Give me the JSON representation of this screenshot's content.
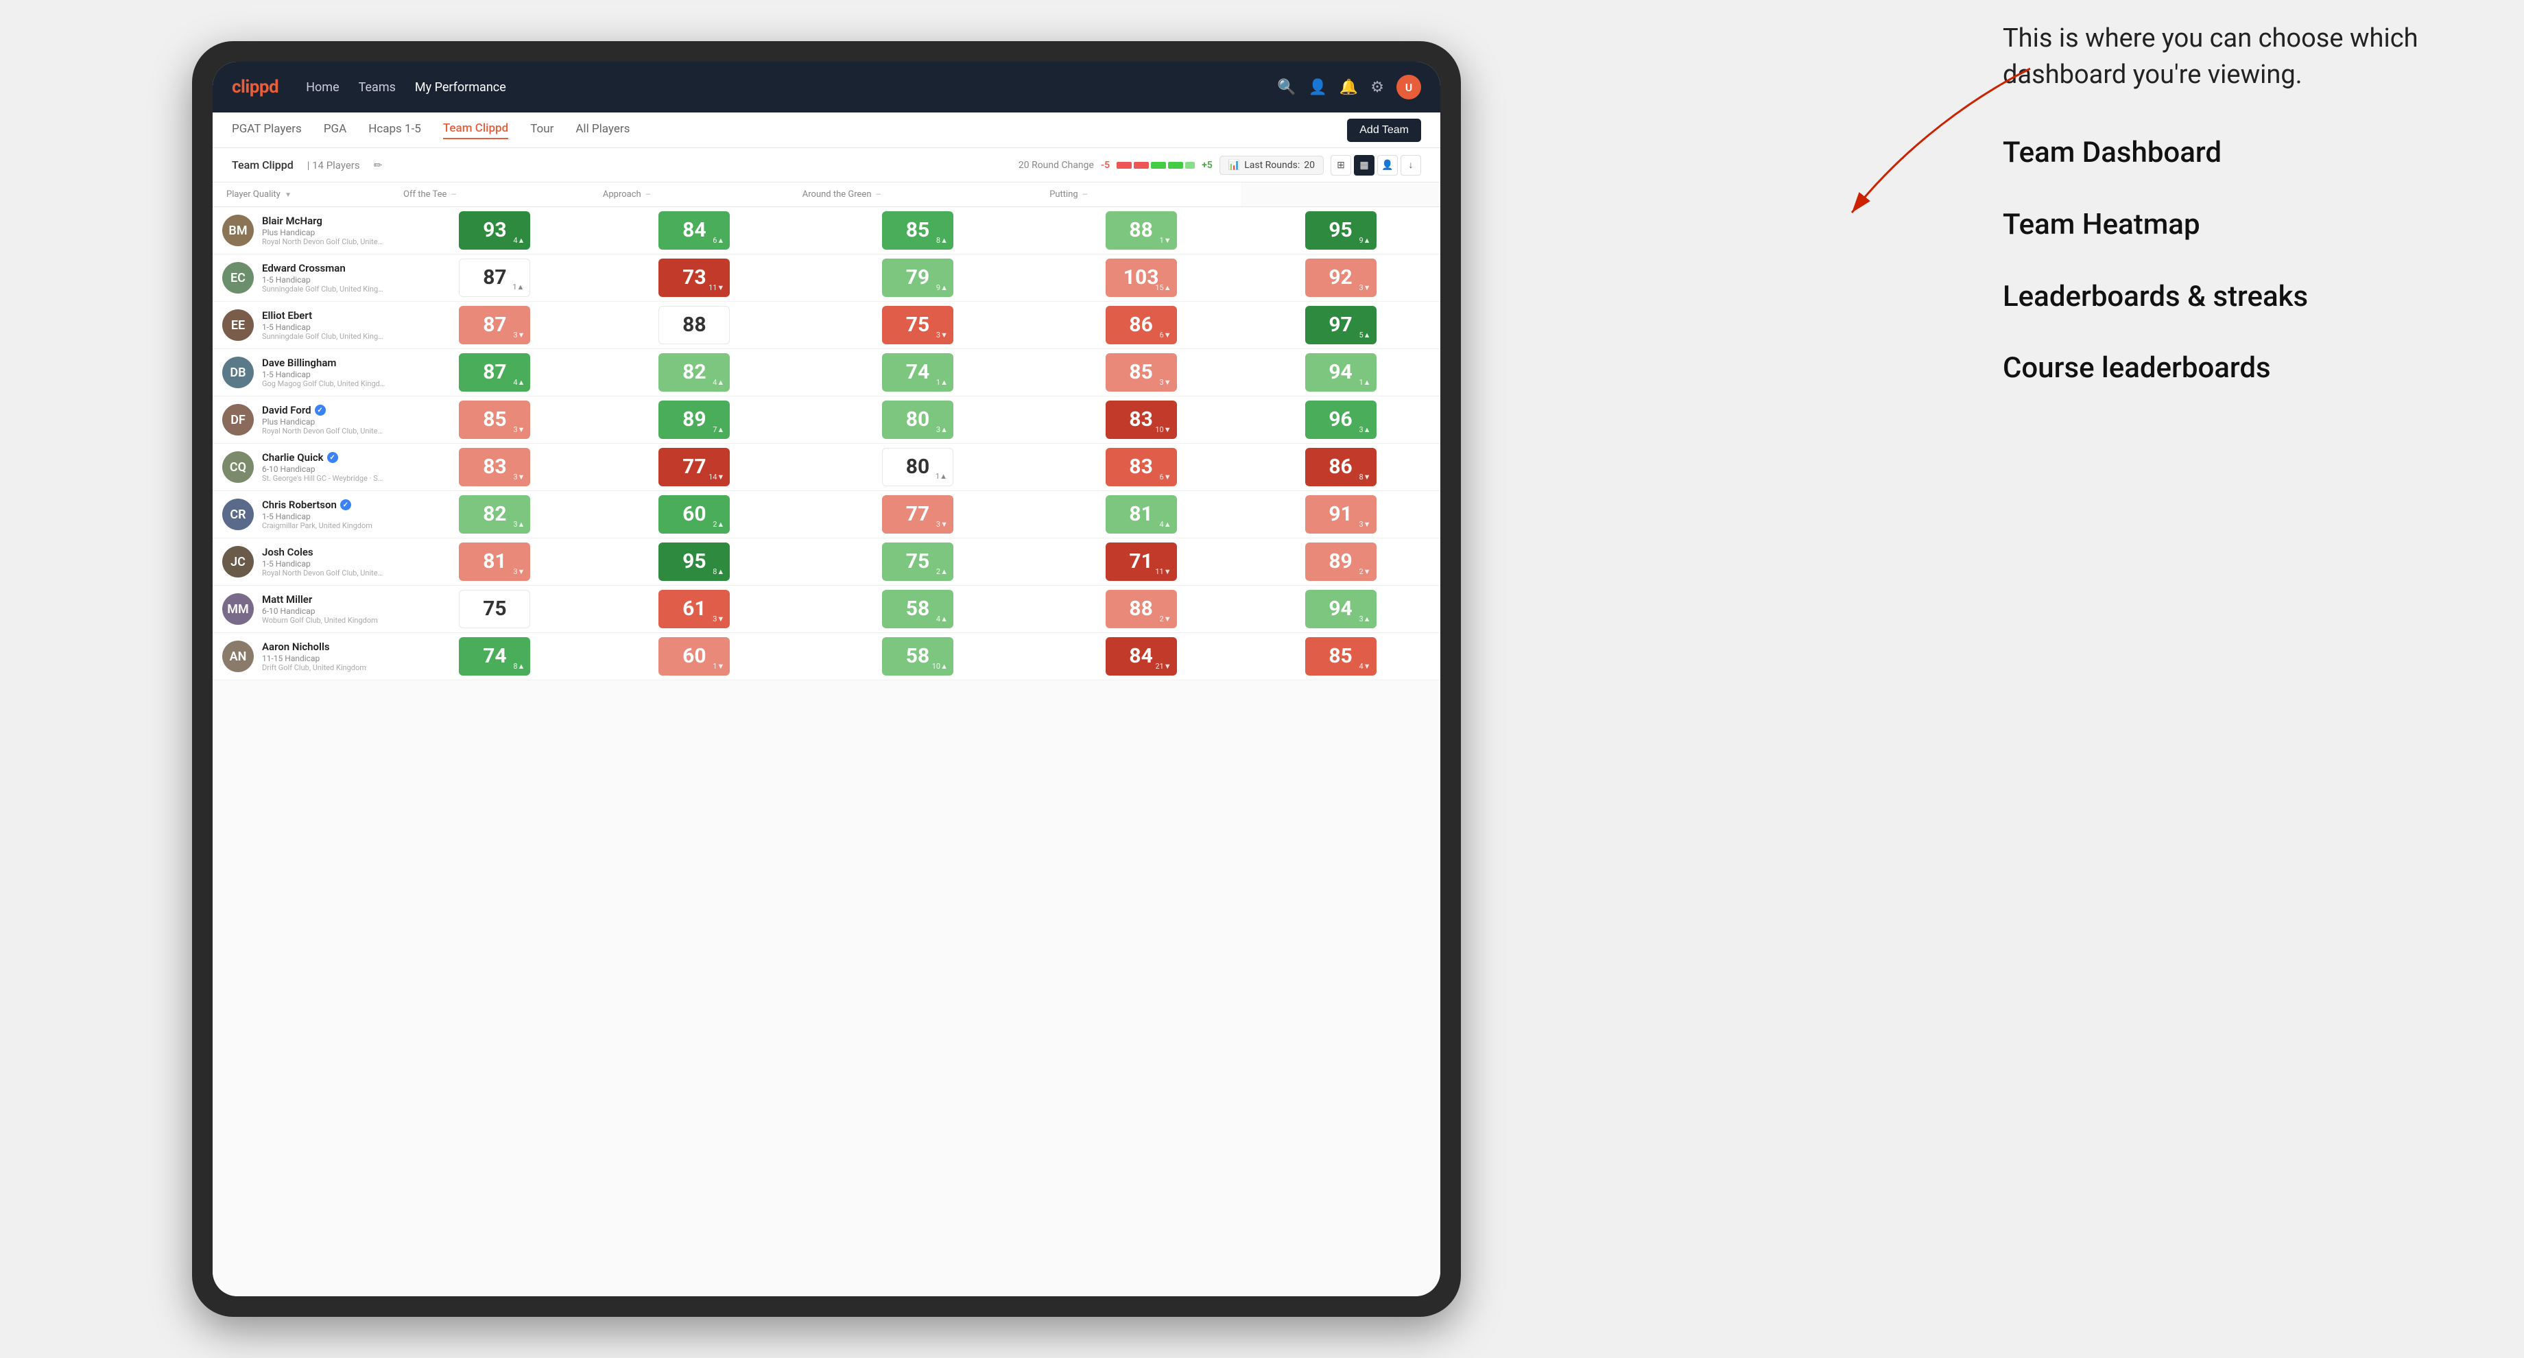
{
  "annotation": {
    "intro": "This is where you can choose which dashboard you're viewing.",
    "items": [
      "Team Dashboard",
      "Team Heatmap",
      "Leaderboards & streaks",
      "Course leaderboards"
    ]
  },
  "navbar": {
    "logo": "clippd",
    "links": [
      "Home",
      "Teams",
      "My Performance"
    ],
    "active_link": "My Performance"
  },
  "subnav": {
    "links": [
      "PGAT Players",
      "PGA",
      "Hcaps 1-5",
      "Team Clippd",
      "Tour",
      "All Players"
    ],
    "active_link": "Team Clippd",
    "add_team_label": "Add Team"
  },
  "team_bar": {
    "team_name": "Team Clippd",
    "separator": "|",
    "player_count": "14 Players",
    "round_change_label": "20 Round Change",
    "round_negative": "-5",
    "round_positive": "+5",
    "last_rounds_label": "Last Rounds:",
    "last_rounds_value": "20"
  },
  "table": {
    "headers": {
      "player": "Player Quality",
      "off_tee": "Off the Tee",
      "approach": "Approach",
      "around_green": "Around the Green",
      "putting": "Putting"
    },
    "players": [
      {
        "name": "Blair McHarg",
        "handicap": "Plus Handicap",
        "club": "Royal North Devon Golf Club, United Kingdom",
        "avatar_color": "#8B7355",
        "initials": "BM",
        "player_quality": {
          "value": 93,
          "change": "+4",
          "direction": "up",
          "color": "green-dark"
        },
        "off_tee": {
          "value": 84,
          "change": "+6",
          "direction": "up",
          "color": "green-mid"
        },
        "approach": {
          "value": 85,
          "change": "+8",
          "direction": "up",
          "color": "green-mid"
        },
        "around_green": {
          "value": 88,
          "change": "-1",
          "direction": "down",
          "color": "green-light"
        },
        "putting": {
          "value": 95,
          "change": "+9",
          "direction": "up",
          "color": "green-dark"
        }
      },
      {
        "name": "Edward Crossman",
        "handicap": "1-5 Handicap",
        "club": "Sunningdale Golf Club, United Kingdom",
        "avatar_color": "#6B8E6B",
        "initials": "EC",
        "player_quality": {
          "value": 87,
          "change": "+1",
          "direction": "up",
          "color": "white"
        },
        "off_tee": {
          "value": 73,
          "change": "-11",
          "direction": "down",
          "color": "red-dark"
        },
        "approach": {
          "value": 79,
          "change": "+9",
          "direction": "up",
          "color": "green-light"
        },
        "around_green": {
          "value": 103,
          "change": "+15",
          "direction": "up",
          "color": "red-light"
        },
        "putting": {
          "value": 92,
          "change": "-3",
          "direction": "down",
          "color": "red-light"
        }
      },
      {
        "name": "Elliot Ebert",
        "handicap": "1-5 Handicap",
        "club": "Sunningdale Golf Club, United Kingdom",
        "avatar_color": "#7A5C4A",
        "initials": "EE",
        "player_quality": {
          "value": 87,
          "change": "-3",
          "direction": "down",
          "color": "red-light"
        },
        "off_tee": {
          "value": 88,
          "change": "",
          "direction": "",
          "color": "white"
        },
        "approach": {
          "value": 75,
          "change": "-3",
          "direction": "down",
          "color": "red-mid"
        },
        "around_green": {
          "value": 86,
          "change": "-6",
          "direction": "down",
          "color": "red-mid"
        },
        "putting": {
          "value": 97,
          "change": "+5",
          "direction": "up",
          "color": "green-dark"
        }
      },
      {
        "name": "Dave Billingham",
        "handicap": "1-5 Handicap",
        "club": "Gog Magog Golf Club, United Kingdom",
        "avatar_color": "#5A7A8A",
        "initials": "DB",
        "player_quality": {
          "value": 87,
          "change": "+4",
          "direction": "up",
          "color": "green-mid"
        },
        "off_tee": {
          "value": 82,
          "change": "+4",
          "direction": "up",
          "color": "green-light"
        },
        "approach": {
          "value": 74,
          "change": "+1",
          "direction": "up",
          "color": "green-light"
        },
        "around_green": {
          "value": 85,
          "change": "-3",
          "direction": "down",
          "color": "red-light"
        },
        "putting": {
          "value": 94,
          "change": "+1",
          "direction": "up",
          "color": "green-light"
        }
      },
      {
        "name": "David Ford",
        "handicap": "Plus Handicap",
        "club": "Royal North Devon Golf Club, United Kingdom",
        "avatar_color": "#8A6A5A",
        "initials": "DF",
        "has_badge": true,
        "player_quality": {
          "value": 85,
          "change": "-3",
          "direction": "down",
          "color": "red-light"
        },
        "off_tee": {
          "value": 89,
          "change": "+7",
          "direction": "up",
          "color": "green-mid"
        },
        "approach": {
          "value": 80,
          "change": "+3",
          "direction": "up",
          "color": "green-light"
        },
        "around_green": {
          "value": 83,
          "change": "-10",
          "direction": "down",
          "color": "red-dark"
        },
        "putting": {
          "value": 96,
          "change": "+3",
          "direction": "up",
          "color": "green-mid"
        }
      },
      {
        "name": "Charlie Quick",
        "handicap": "6-10 Handicap",
        "club": "St. George's Hill GC - Weybridge · Surrey, Uni...",
        "avatar_color": "#7A8A6A",
        "initials": "CQ",
        "has_badge": true,
        "player_quality": {
          "value": 83,
          "change": "-3",
          "direction": "down",
          "color": "red-light"
        },
        "off_tee": {
          "value": 77,
          "change": "-14",
          "direction": "down",
          "color": "red-dark"
        },
        "approach": {
          "value": 80,
          "change": "+1",
          "direction": "up",
          "color": "white"
        },
        "around_green": {
          "value": 83,
          "change": "-6",
          "direction": "down",
          "color": "red-mid"
        },
        "putting": {
          "value": 86,
          "change": "-8",
          "direction": "down",
          "color": "red-dark"
        }
      },
      {
        "name": "Chris Robertson",
        "handicap": "1-5 Handicap",
        "club": "Craigmillar Park, United Kingdom",
        "avatar_color": "#5A6A8A",
        "initials": "CR",
        "has_badge": true,
        "player_quality": {
          "value": 82,
          "change": "+3",
          "direction": "up",
          "color": "green-light"
        },
        "off_tee": {
          "value": 60,
          "change": "+2",
          "direction": "up",
          "color": "green-mid"
        },
        "approach": {
          "value": 77,
          "change": "-3",
          "direction": "down",
          "color": "red-light"
        },
        "around_green": {
          "value": 81,
          "change": "+4",
          "direction": "up",
          "color": "green-light"
        },
        "putting": {
          "value": 91,
          "change": "-3",
          "direction": "down",
          "color": "red-light"
        }
      },
      {
        "name": "Josh Coles",
        "handicap": "1-5 Handicap",
        "club": "Royal North Devon Golf Club, United Kingdom",
        "avatar_color": "#6A5A4A",
        "initials": "JC",
        "player_quality": {
          "value": 81,
          "change": "-3",
          "direction": "down",
          "color": "red-light"
        },
        "off_tee": {
          "value": 95,
          "change": "+8",
          "direction": "up",
          "color": "green-dark"
        },
        "approach": {
          "value": 75,
          "change": "+2",
          "direction": "up",
          "color": "green-light"
        },
        "around_green": {
          "value": 71,
          "change": "-11",
          "direction": "down",
          "color": "red-dark"
        },
        "putting": {
          "value": 89,
          "change": "-2",
          "direction": "down",
          "color": "red-light"
        }
      },
      {
        "name": "Matt Miller",
        "handicap": "6-10 Handicap",
        "club": "Woburn Golf Club, United Kingdom",
        "avatar_color": "#7A6A8A",
        "initials": "MM",
        "player_quality": {
          "value": 75,
          "change": "",
          "direction": "",
          "color": "white"
        },
        "off_tee": {
          "value": 61,
          "change": "-3",
          "direction": "down",
          "color": "red-mid"
        },
        "approach": {
          "value": 58,
          "change": "+4",
          "direction": "up",
          "color": "green-light"
        },
        "around_green": {
          "value": 88,
          "change": "-2",
          "direction": "down",
          "color": "red-light"
        },
        "putting": {
          "value": 94,
          "change": "+3",
          "direction": "up",
          "color": "green-light"
        }
      },
      {
        "name": "Aaron Nicholls",
        "handicap": "11-15 Handicap",
        "club": "Drift Golf Club, United Kingdom",
        "avatar_color": "#8A7A6A",
        "initials": "AN",
        "player_quality": {
          "value": 74,
          "change": "+8",
          "direction": "up",
          "color": "green-mid"
        },
        "off_tee": {
          "value": 60,
          "change": "-1",
          "direction": "down",
          "color": "red-light"
        },
        "approach": {
          "value": 58,
          "change": "+10",
          "direction": "up",
          "color": "green-light"
        },
        "around_green": {
          "value": 84,
          "change": "-21",
          "direction": "down",
          "color": "red-dark"
        },
        "putting": {
          "value": 85,
          "change": "-4",
          "direction": "down",
          "color": "red-mid"
        }
      }
    ]
  },
  "colors": {
    "green_dark": "#2d8a3e",
    "green_mid": "#4aad5a",
    "green_light": "#7dc67f",
    "red_dark": "#c23b2a",
    "red_mid": "#e05d4a",
    "red_light": "#e8a090",
    "white_cell": "#ffffff",
    "accent": "#e85d3a"
  }
}
